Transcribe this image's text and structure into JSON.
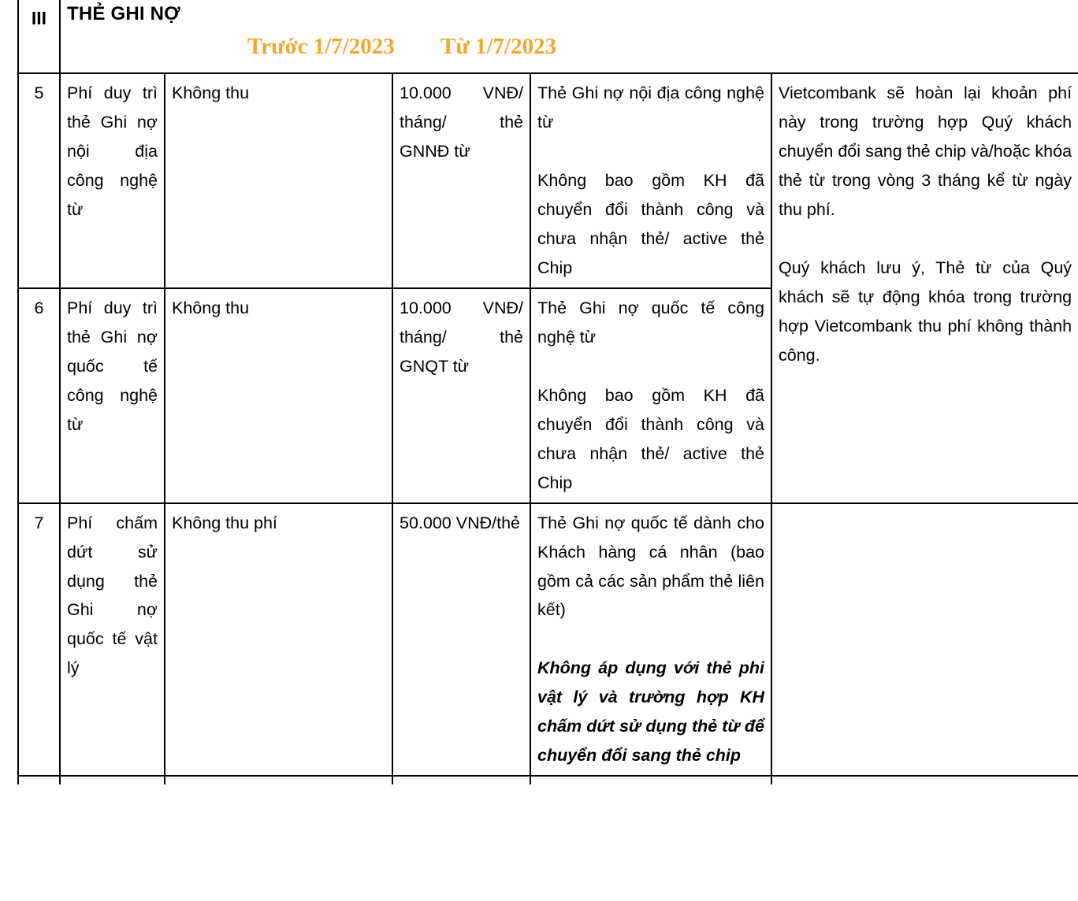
{
  "document": {
    "section": {
      "numeral": "III",
      "title": "THẺ GHI NỢ"
    },
    "period_headers": {
      "before": "Trước 1/7/2023",
      "after": "Từ 1/7/2023"
    }
  },
  "table": {
    "rows": [
      {
        "index": "5",
        "fee_name": "Phí duy trì thẻ Ghi nợ nội địa công nghệ từ",
        "old_fee": "Không thu",
        "new_fee": "10.000 VNĐ/ tháng/ thẻ GNNĐ từ",
        "note_para1": "Thẻ Ghi nợ nội địa công nghệ từ",
        "note_para2": "Không bao gồm KH đã chuyển đổi thành công và chưa nhận thẻ/ active thẻ Chip",
        "remark_para1": "Vietcombank sẽ hoàn lại khoản phí này trong trường hợp Quý khách chuyển đổi sang thẻ chip và/hoặc khóa thẻ từ trong vòng 3 tháng kể từ ngày thu phí.",
        "remark_para2": "Quý khách lưu ý, Thẻ từ của Quý khách sẽ tự động khóa trong trường hợp Vietcombank thu phí không thành công."
      },
      {
        "index": "6",
        "fee_name": "Phí duy trì thẻ Ghi nợ quốc tế công nghệ từ",
        "old_fee": "Không thu",
        "new_fee": "10.000 VNĐ/ tháng/ thẻ GNQT từ",
        "note_para1": "Thẻ Ghi nợ quốc tế công nghệ từ",
        "note_para2": "Không bao gồm KH đã chuyển đổi thành công và chưa nhận thẻ/ active thẻ Chip"
      },
      {
        "index": "7",
        "fee_name": "Phí chấm dứt sử dụng thẻ Ghi nợ quốc tế vật lý",
        "old_fee": "Không thu phí",
        "new_fee": "50.000 VNĐ/thẻ",
        "note_para1": "Thẻ Ghi nợ quốc tế dành cho Khách hàng cá nhân (bao gồm cả các sản phẩm thẻ liên kết)",
        "note_para2_bold_italic": "Không áp dụng với thẻ phi vật lý và trường hợp KH chấm dứt sử dụng thẻ từ để chuyển đổi sang thẻ chip",
        "remark": ""
      }
    ]
  },
  "colors": {
    "period_header_text": "#F0A830",
    "grid_line": "#000000",
    "body_text": "#000000",
    "background": "#FFFFFF"
  }
}
